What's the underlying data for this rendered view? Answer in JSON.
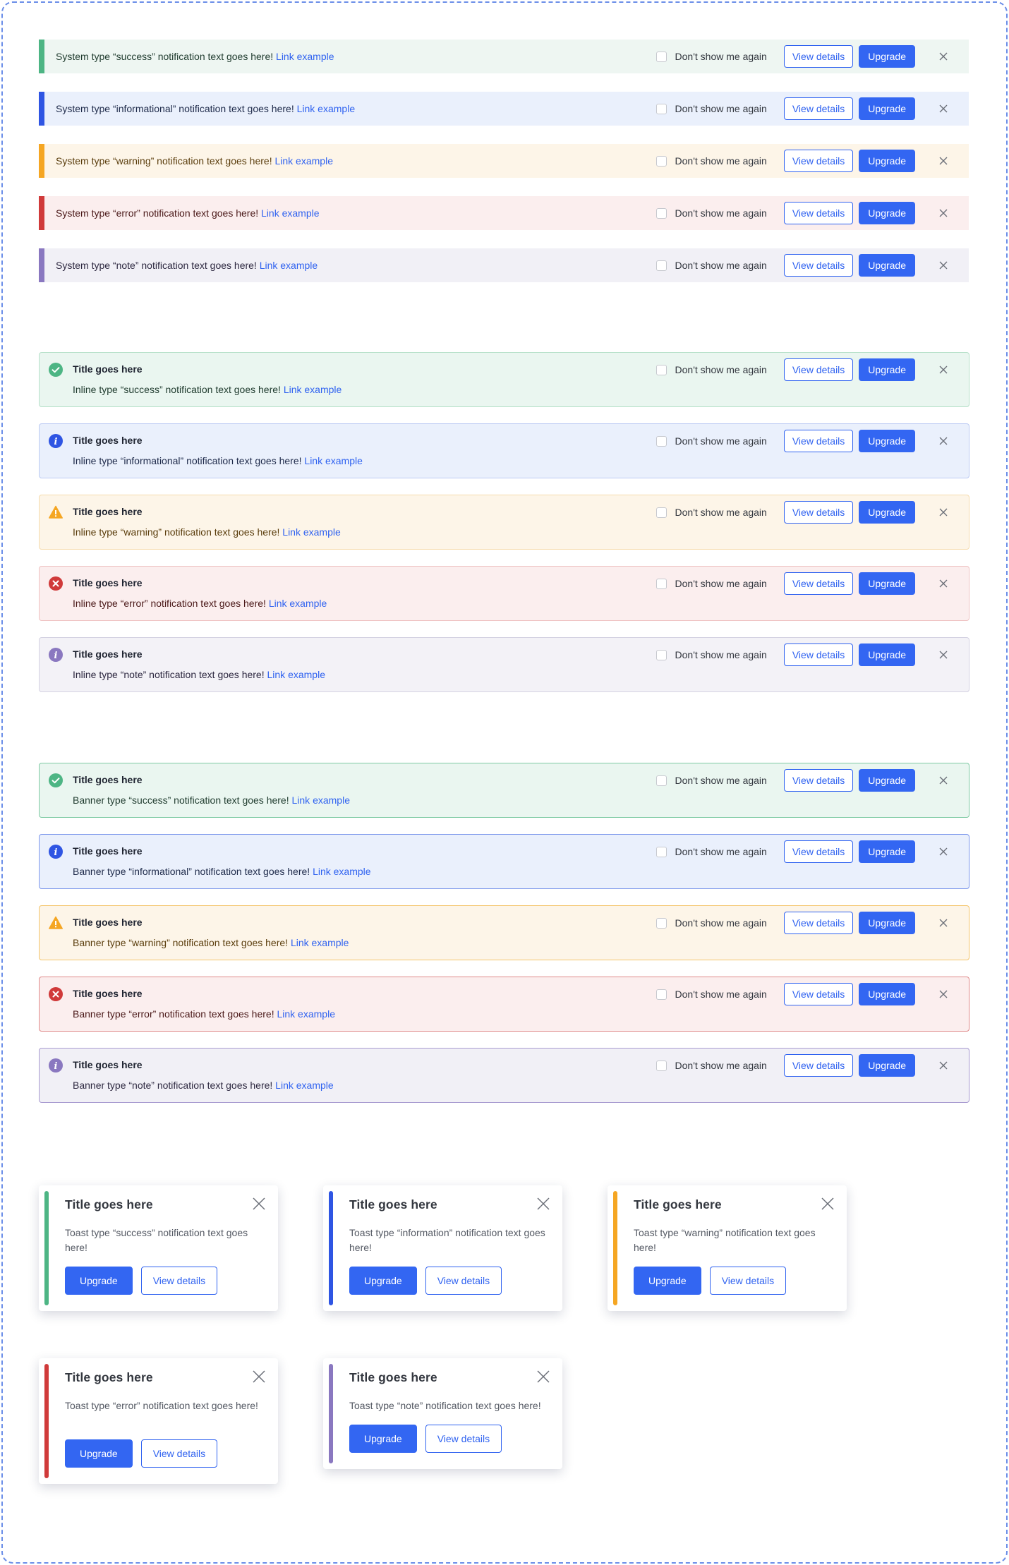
{
  "common": {
    "dont_show": "Don't show me again",
    "view_details": "View details",
    "upgrade": "Upgrade",
    "link_example": "Link example",
    "title": "Title goes here"
  },
  "colors": {
    "success": "#4db584",
    "informational": "#2f55e3",
    "warning": "#f5a623",
    "error": "#d03a3a",
    "note": "#8a78c0"
  },
  "system": [
    {
      "type": "success",
      "text": "System type “success” notification text goes here!"
    },
    {
      "type": "informational",
      "text": "System type “informational” notification text goes here!"
    },
    {
      "type": "warning",
      "text": "System type “warning” notification text goes here!"
    },
    {
      "type": "error",
      "text": "System type “error” notification text goes here!"
    },
    {
      "type": "note",
      "text": "System type “note” notification text goes here!"
    }
  ],
  "inline": [
    {
      "type": "success",
      "icon": "check-circle-icon",
      "text": "Inline type “success” notification text goes here!"
    },
    {
      "type": "informational",
      "icon": "info-circle-icon",
      "text": "Inline type “informational” notification text goes here!"
    },
    {
      "type": "warning",
      "icon": "warning-triangle-icon",
      "text": "Inline type “warning” notification text goes here!"
    },
    {
      "type": "error",
      "icon": "error-circle-icon",
      "text": "Inline type “error” notification text goes here!"
    },
    {
      "type": "note",
      "icon": "note-circle-icon",
      "text": "Inline type “note” notification text goes here!"
    }
  ],
  "banner": [
    {
      "type": "success",
      "icon": "check-circle-icon",
      "text": "Banner type “success” notification text goes here!"
    },
    {
      "type": "informational",
      "icon": "info-circle-icon",
      "text": "Banner type “informational” notification text goes here!"
    },
    {
      "type": "warning",
      "icon": "warning-triangle-icon",
      "text": "Banner type “warning” notification text goes here!"
    },
    {
      "type": "error",
      "icon": "error-circle-icon",
      "text": "Banner type “error” notification text goes here!"
    },
    {
      "type": "note",
      "icon": "note-circle-icon",
      "text": "Banner type “note” notification text goes here!"
    }
  ],
  "toast": [
    {
      "type": "success",
      "title": "Title goes here",
      "text": "Toast type “success” notification text goes here!"
    },
    {
      "type": "informational",
      "title": "Title goes here",
      "text": "Toast type “information” notification text goes here!"
    },
    {
      "type": "warning",
      "title": "Title goes here",
      "text": "Toast type “warning” notification text goes here!"
    },
    {
      "type": "error",
      "title": "Title goes here",
      "text": "Toast type “error” notification text goes here!"
    },
    {
      "type": "note",
      "title": "Title goes here",
      "text": "Toast type “note” notification text goes here!"
    }
  ]
}
